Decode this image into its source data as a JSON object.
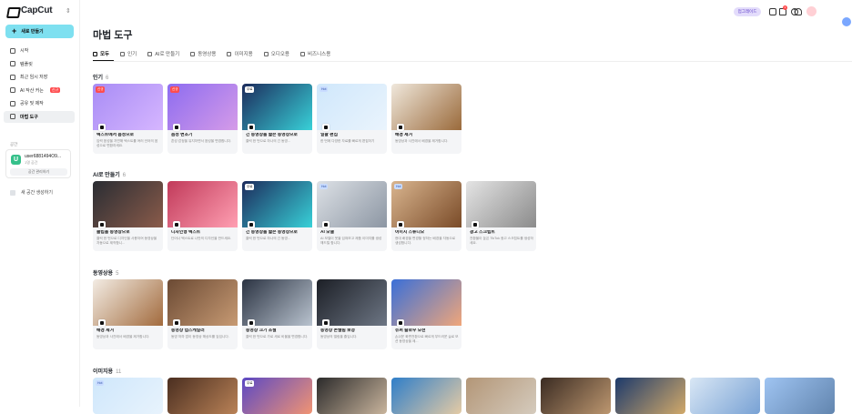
{
  "app": {
    "logo": "CapCut"
  },
  "sidebar": {
    "new_button": "새로 만들기",
    "items": [
      {
        "label": "시작",
        "icon": "home-icon"
      },
      {
        "label": "템플릿",
        "icon": "template-icon"
      },
      {
        "label": "최근 임시 저장",
        "icon": "clock-icon"
      },
      {
        "label": "AI 작산 커는",
        "icon": "ai-icon",
        "badge": "신규"
      },
      {
        "label": "공유 및 제작",
        "icon": "share-icon"
      },
      {
        "label": "마법 도구",
        "icon": "magic-icon",
        "active": true
      }
    ],
    "space_label": "공간",
    "user": {
      "initial": "U",
      "name": "user6881494O9...",
      "sub": "1명 공간",
      "button": "공간 관리하기"
    },
    "new_space": "새 공간 생성하기"
  },
  "topbar": {
    "upgrade": "업그레이드",
    "notif_count": "1"
  },
  "main": {
    "title": "마법 도구",
    "tabs": [
      "모두",
      "인기",
      "AI로 만들기",
      "동영상용",
      "이미지용",
      "오디오용",
      "비즈니스용"
    ]
  },
  "sections": [
    {
      "title": "인기",
      "count": "6",
      "cards": [
        {
          "title": "텍스트에서 음성으로",
          "desc": "입력 음성을 자연해 텍스트를 여러 언어의 음성으로 변환하세요.",
          "tag": "신규",
          "tag_style": "red"
        },
        {
          "title": "음성 변조기",
          "desc": "혼성 감정을 유지하면서 음성을 변경합니다.",
          "tag": "신규",
          "tag_style": "red"
        },
        {
          "title": "긴 동영상을 짧은 동영상으로",
          "desc": "클릭 한 번으로 하나의 긴 동영...",
          "tag": "무료",
          "tag_style": "white"
        },
        {
          "title": "일괄 편집",
          "desc": "한 번에 다양한 자료를 빠르게 편집하기",
          "tag": "Hot",
          "tag_style": "blue"
        },
        {
          "title": "배경 제거",
          "desc": "동영상과 사진에서 배경을 제거합니다.",
          "tag": "",
          "tag_style": ""
        }
      ]
    },
    {
      "title": "AI로 만들기",
      "count": "6",
      "cards": [
        {
          "title": "클립을 동영상으로",
          "desc": "클릭 한 번으로 디자인을 사용하여 동영상을 자동으로 제작합니...",
          "tag": "",
          "tag_style": ""
        },
        {
          "title": "디자인형 텍스트",
          "desc": "단어나 텍스트로 나만의 디자인을 만드세요.",
          "tag": "",
          "tag_style": ""
        },
        {
          "title": "긴 동영상을 짧은 동영상으로",
          "desc": "클릭 한 번으로 하나의 긴 동영...",
          "tag": "무료",
          "tag_style": "white"
        },
        {
          "title": "AI 모델",
          "desc": "AI 모델이 옷을 입혀보고 제품 이미지를 생성해드릴 합니다.",
          "tag": "Hot",
          "tag_style": "blue"
        },
        {
          "title": "이미지 스튜디오",
          "desc": "현대 배경을 변경할 정하는 배경을 자동으로 생성합니다.",
          "tag": "Hot",
          "tag_style": "blue"
        },
        {
          "title": "광고 스크립트",
          "desc": "전환율이 높은 TikTok 광고 스크립트를 생성하세요.",
          "tag": "",
          "tag_style": ""
        }
      ]
    },
    {
      "title": "동영상용",
      "count": "5",
      "cards": [
        {
          "title": "배경 제거",
          "desc": "동영상과 사진에서 배경을 제거합니다.",
          "tag": "",
          "tag_style": ""
        },
        {
          "title": "동영상 업스케일러",
          "desc": "동영 저하 없이 동영상 해상도를 높입니다.",
          "tag": "",
          "tag_style": ""
        },
        {
          "title": "동영상 크기 조절",
          "desc": "클릭 한 번으로 가로 세로 비율을 변경합니다.",
          "tag": "",
          "tag_style": ""
        },
        {
          "title": "동영상 손떨림 보정",
          "desc": "동영상의 떨림을 줄입니다.",
          "tag": "",
          "tag_style": ""
        },
        {
          "title": "슈퍼 슬로우 모션",
          "desc": "손쉬운 화면전환으로 빠르게 부드러운 슬로 모션 동영상을 제...",
          "tag": "",
          "tag_style": ""
        }
      ]
    },
    {
      "title": "이미지용",
      "count": "11",
      "cards": [
        {
          "tag": "Hot",
          "tag_style": "blue"
        },
        {
          "tag": "",
          "tag_style": ""
        },
        {
          "tag": "무료",
          "tag_style": "white"
        },
        {
          "tag": "",
          "tag_style": ""
        },
        {
          "tag": "",
          "tag_style": ""
        },
        {
          "tag": "",
          "tag_style": ""
        },
        {
          "tag": "",
          "tag_style": ""
        },
        {
          "tag": "",
          "tag_style": ""
        },
        {
          "tag": "",
          "tag_style": ""
        },
        {
          "tag": "",
          "tag_style": ""
        }
      ]
    }
  ],
  "colors": {
    "accent": "#7ee0f0",
    "badge": "#ff4d4f",
    "upgrade_bg": "#e3dcfb"
  }
}
